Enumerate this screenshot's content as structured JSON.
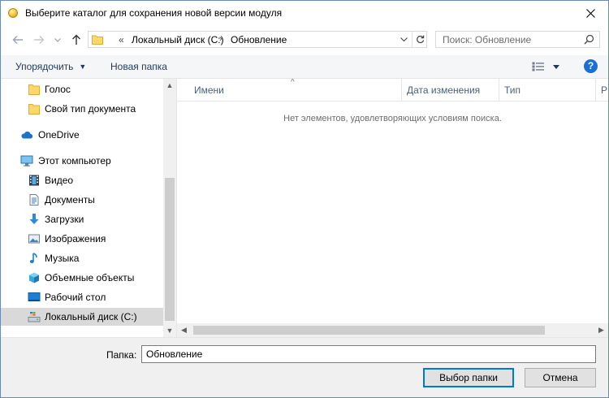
{
  "window": {
    "title": "Выберите каталог для сохранения новой версии модуля"
  },
  "address": {
    "overflow": "«",
    "parts": [
      "Локальный диск (C:)",
      "Обновление"
    ],
    "separator": "›"
  },
  "search": {
    "placeholder": "Поиск: Обновление"
  },
  "toolbar": {
    "organize": "Упорядочить",
    "new_folder": "Новая папка",
    "help": "?"
  },
  "nav": {
    "items": [
      {
        "label": "Голос",
        "icon": "folder-icon"
      },
      {
        "label": "Свой тип документа",
        "icon": "folder-icon"
      },
      {
        "label": "OneDrive",
        "icon": "onedrive-cloud-icon"
      },
      {
        "label": "Этот компьютер",
        "icon": "computer-icon"
      },
      {
        "label": "Видео",
        "icon": "video-icon"
      },
      {
        "label": "Документы",
        "icon": "documents-icon"
      },
      {
        "label": "Загрузки",
        "icon": "download-icon"
      },
      {
        "label": "Изображения",
        "icon": "pictures-icon"
      },
      {
        "label": "Музыка",
        "icon": "music-icon"
      },
      {
        "label": "Объемные объекты",
        "icon": "3d-objects-icon"
      },
      {
        "label": "Рабочий стол",
        "icon": "desktop-icon"
      },
      {
        "label": "Локальный диск (C:)",
        "icon": "local-disk-icon",
        "selected": true
      }
    ]
  },
  "list": {
    "columns": [
      "Имени",
      "Дата изменения",
      "Тип",
      "Р"
    ],
    "empty_message": "Нет элементов, удовлетворяющих условиям поиска."
  },
  "footer": {
    "folder_label": "Папка:",
    "folder_value": "Обновление",
    "select_button": "Выбор папки",
    "cancel_button": "Отмена"
  },
  "colors": {
    "accent": "#0078d7",
    "selection": "#d9d9d9",
    "link_text": "#1e395b"
  }
}
